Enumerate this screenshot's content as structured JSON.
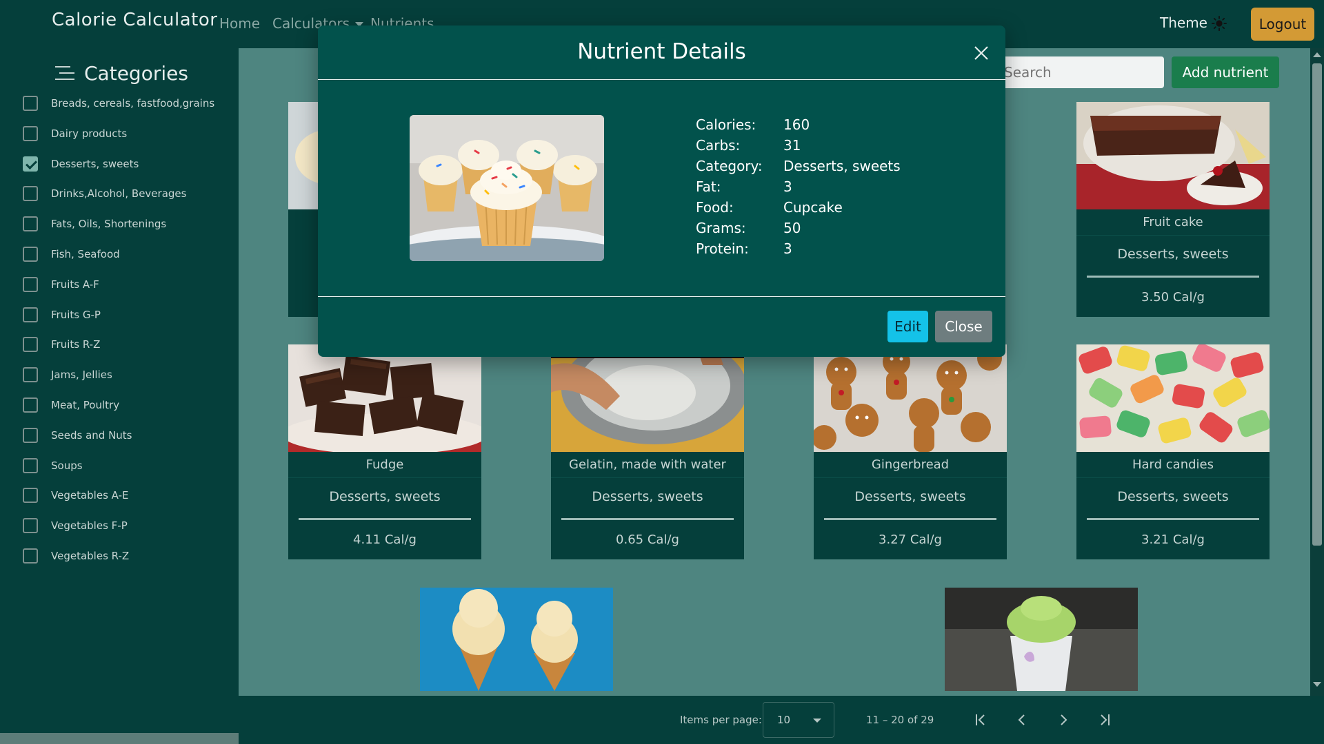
{
  "navbar": {
    "brand": "Calorie Calculator",
    "links": {
      "home": "Home",
      "calculators": "Calculators",
      "nutrients": "Nutrients"
    },
    "theme_label": "Theme",
    "logout_label": "Logout"
  },
  "sidebar": {
    "title": "Categories",
    "items": [
      {
        "label": "Breads, cereals, fastfood,grains",
        "checked": false
      },
      {
        "label": "Dairy products",
        "checked": false
      },
      {
        "label": "Desserts, sweets",
        "checked": true
      },
      {
        "label": "Drinks,Alcohol, Beverages",
        "checked": false
      },
      {
        "label": "Fats, Oils, Shortenings",
        "checked": false
      },
      {
        "label": "Fish, Seafood",
        "checked": false
      },
      {
        "label": "Fruits A-F",
        "checked": false
      },
      {
        "label": "Fruits G-P",
        "checked": false
      },
      {
        "label": "Fruits R-Z",
        "checked": false
      },
      {
        "label": "Jams, Jellies",
        "checked": false
      },
      {
        "label": "Meat, Poultry",
        "checked": false
      },
      {
        "label": "Seeds and Nuts",
        "checked": false
      },
      {
        "label": "Soups",
        "checked": false
      },
      {
        "label": "Vegetables A-E",
        "checked": false
      },
      {
        "label": "Vegetables F-P",
        "checked": false
      },
      {
        "label": "Vegetables R-Z",
        "checked": false
      }
    ]
  },
  "toolbar": {
    "search_placeholder": "Search",
    "add_label": "Add nutrient"
  },
  "cards": [
    {
      "name": "Fruit cake",
      "category": "Desserts, sweets",
      "cal": "3.50 Cal/g"
    },
    {
      "name": "Fudge",
      "category": "Desserts, sweets",
      "cal": "4.11 Cal/g"
    },
    {
      "name": "Gelatin, made with water",
      "category": "Desserts, sweets",
      "cal": "0.65 Cal/g"
    },
    {
      "name": "Gingerbread",
      "category": "Desserts, sweets",
      "cal": "3.27 Cal/g"
    },
    {
      "name": "Hard candies",
      "category": "Desserts, sweets",
      "cal": "3.21 Cal/g"
    }
  ],
  "paginator": {
    "items_per_page_label": "Items per page:",
    "items_per_page_value": "10",
    "range": "11 – 20 of 29"
  },
  "modal": {
    "title": "Nutrient Details",
    "details": [
      {
        "key": "Calories:",
        "value": "160"
      },
      {
        "key": "Carbs:",
        "value": "31"
      },
      {
        "key": "Category:",
        "value": "Desserts, sweets"
      },
      {
        "key": "Fat:",
        "value": "3"
      },
      {
        "key": "Food:",
        "value": "Cupcake"
      },
      {
        "key": "Grams:",
        "value": "50"
      },
      {
        "key": "Protein:",
        "value": "3"
      }
    ],
    "edit_label": "Edit",
    "close_label": "Close"
  },
  "colors": {
    "navbar": "#053f3b",
    "modal": "#02524c",
    "edit_button": "#14c2e8",
    "add_button": "#1a7d4c",
    "logout_button": "#d39a35"
  }
}
